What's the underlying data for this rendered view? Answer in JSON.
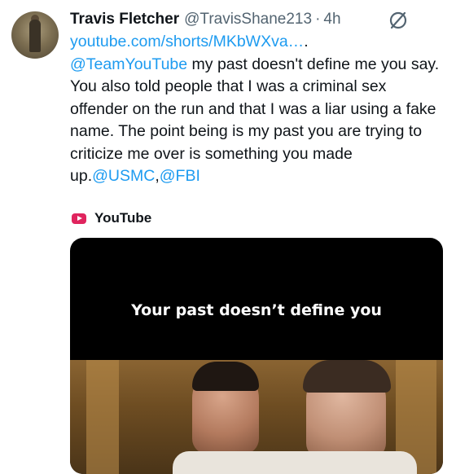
{
  "tweet": {
    "author_name": "Travis Fletcher",
    "author_handle": "@TravisShane213",
    "separator": "·",
    "time": "4h",
    "link_text": "youtube.com/shorts/MKbWXva…",
    "link_trailing": ".",
    "mention_teamyoutube": "@TeamYouTube",
    "body_text": " my past doesn't define me you say. You also told people that I was a criminal sex offender on the run and that I was a liar using a fake name. The point being is my past you are trying to criticize me over is something you made up.",
    "mention_usmc": "@USMC",
    "comma": ",",
    "mention_fbi": "@FBI"
  },
  "card": {
    "source_icon": "youtube-icon",
    "source_label": "YouTube",
    "video_caption": "Your past doesn’t define you"
  },
  "colors": {
    "link": "#1d9bf0",
    "text": "#0f1419",
    "muted": "#536471",
    "youtube_icon": "#e0245e"
  }
}
